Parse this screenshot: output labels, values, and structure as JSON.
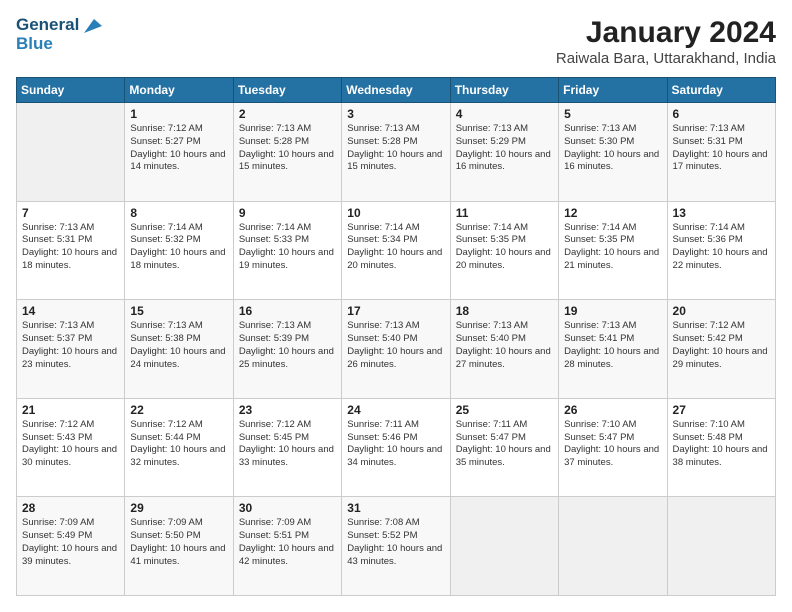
{
  "logo": {
    "line1": "General",
    "line2": "Blue"
  },
  "title": "January 2024",
  "subtitle": "Raiwala Bara, Uttarakhand, India",
  "weekdays": [
    "Sunday",
    "Monday",
    "Tuesday",
    "Wednesday",
    "Thursday",
    "Friday",
    "Saturday"
  ],
  "weeks": [
    [
      {
        "day": "",
        "sunrise": "",
        "sunset": "",
        "daylight": ""
      },
      {
        "day": "1",
        "sunrise": "Sunrise: 7:12 AM",
        "sunset": "Sunset: 5:27 PM",
        "daylight": "Daylight: 10 hours and 14 minutes."
      },
      {
        "day": "2",
        "sunrise": "Sunrise: 7:13 AM",
        "sunset": "Sunset: 5:28 PM",
        "daylight": "Daylight: 10 hours and 15 minutes."
      },
      {
        "day": "3",
        "sunrise": "Sunrise: 7:13 AM",
        "sunset": "Sunset: 5:28 PM",
        "daylight": "Daylight: 10 hours and 15 minutes."
      },
      {
        "day": "4",
        "sunrise": "Sunrise: 7:13 AM",
        "sunset": "Sunset: 5:29 PM",
        "daylight": "Daylight: 10 hours and 16 minutes."
      },
      {
        "day": "5",
        "sunrise": "Sunrise: 7:13 AM",
        "sunset": "Sunset: 5:30 PM",
        "daylight": "Daylight: 10 hours and 16 minutes."
      },
      {
        "day": "6",
        "sunrise": "Sunrise: 7:13 AM",
        "sunset": "Sunset: 5:31 PM",
        "daylight": "Daylight: 10 hours and 17 minutes."
      }
    ],
    [
      {
        "day": "7",
        "sunrise": "Sunrise: 7:13 AM",
        "sunset": "Sunset: 5:31 PM",
        "daylight": "Daylight: 10 hours and 18 minutes."
      },
      {
        "day": "8",
        "sunrise": "Sunrise: 7:14 AM",
        "sunset": "Sunset: 5:32 PM",
        "daylight": "Daylight: 10 hours and 18 minutes."
      },
      {
        "day": "9",
        "sunrise": "Sunrise: 7:14 AM",
        "sunset": "Sunset: 5:33 PM",
        "daylight": "Daylight: 10 hours and 19 minutes."
      },
      {
        "day": "10",
        "sunrise": "Sunrise: 7:14 AM",
        "sunset": "Sunset: 5:34 PM",
        "daylight": "Daylight: 10 hours and 20 minutes."
      },
      {
        "day": "11",
        "sunrise": "Sunrise: 7:14 AM",
        "sunset": "Sunset: 5:35 PM",
        "daylight": "Daylight: 10 hours and 20 minutes."
      },
      {
        "day": "12",
        "sunrise": "Sunrise: 7:14 AM",
        "sunset": "Sunset: 5:35 PM",
        "daylight": "Daylight: 10 hours and 21 minutes."
      },
      {
        "day": "13",
        "sunrise": "Sunrise: 7:14 AM",
        "sunset": "Sunset: 5:36 PM",
        "daylight": "Daylight: 10 hours and 22 minutes."
      }
    ],
    [
      {
        "day": "14",
        "sunrise": "Sunrise: 7:13 AM",
        "sunset": "Sunset: 5:37 PM",
        "daylight": "Daylight: 10 hours and 23 minutes."
      },
      {
        "day": "15",
        "sunrise": "Sunrise: 7:13 AM",
        "sunset": "Sunset: 5:38 PM",
        "daylight": "Daylight: 10 hours and 24 minutes."
      },
      {
        "day": "16",
        "sunrise": "Sunrise: 7:13 AM",
        "sunset": "Sunset: 5:39 PM",
        "daylight": "Daylight: 10 hours and 25 minutes."
      },
      {
        "day": "17",
        "sunrise": "Sunrise: 7:13 AM",
        "sunset": "Sunset: 5:40 PM",
        "daylight": "Daylight: 10 hours and 26 minutes."
      },
      {
        "day": "18",
        "sunrise": "Sunrise: 7:13 AM",
        "sunset": "Sunset: 5:40 PM",
        "daylight": "Daylight: 10 hours and 27 minutes."
      },
      {
        "day": "19",
        "sunrise": "Sunrise: 7:13 AM",
        "sunset": "Sunset: 5:41 PM",
        "daylight": "Daylight: 10 hours and 28 minutes."
      },
      {
        "day": "20",
        "sunrise": "Sunrise: 7:12 AM",
        "sunset": "Sunset: 5:42 PM",
        "daylight": "Daylight: 10 hours and 29 minutes."
      }
    ],
    [
      {
        "day": "21",
        "sunrise": "Sunrise: 7:12 AM",
        "sunset": "Sunset: 5:43 PM",
        "daylight": "Daylight: 10 hours and 30 minutes."
      },
      {
        "day": "22",
        "sunrise": "Sunrise: 7:12 AM",
        "sunset": "Sunset: 5:44 PM",
        "daylight": "Daylight: 10 hours and 32 minutes."
      },
      {
        "day": "23",
        "sunrise": "Sunrise: 7:12 AM",
        "sunset": "Sunset: 5:45 PM",
        "daylight": "Daylight: 10 hours and 33 minutes."
      },
      {
        "day": "24",
        "sunrise": "Sunrise: 7:11 AM",
        "sunset": "Sunset: 5:46 PM",
        "daylight": "Daylight: 10 hours and 34 minutes."
      },
      {
        "day": "25",
        "sunrise": "Sunrise: 7:11 AM",
        "sunset": "Sunset: 5:47 PM",
        "daylight": "Daylight: 10 hours and 35 minutes."
      },
      {
        "day": "26",
        "sunrise": "Sunrise: 7:10 AM",
        "sunset": "Sunset: 5:47 PM",
        "daylight": "Daylight: 10 hours and 37 minutes."
      },
      {
        "day": "27",
        "sunrise": "Sunrise: 7:10 AM",
        "sunset": "Sunset: 5:48 PM",
        "daylight": "Daylight: 10 hours and 38 minutes."
      }
    ],
    [
      {
        "day": "28",
        "sunrise": "Sunrise: 7:09 AM",
        "sunset": "Sunset: 5:49 PM",
        "daylight": "Daylight: 10 hours and 39 minutes."
      },
      {
        "day": "29",
        "sunrise": "Sunrise: 7:09 AM",
        "sunset": "Sunset: 5:50 PM",
        "daylight": "Daylight: 10 hours and 41 minutes."
      },
      {
        "day": "30",
        "sunrise": "Sunrise: 7:09 AM",
        "sunset": "Sunset: 5:51 PM",
        "daylight": "Daylight: 10 hours and 42 minutes."
      },
      {
        "day": "31",
        "sunrise": "Sunrise: 7:08 AM",
        "sunset": "Sunset: 5:52 PM",
        "daylight": "Daylight: 10 hours and 43 minutes."
      },
      {
        "day": "",
        "sunrise": "",
        "sunset": "",
        "daylight": ""
      },
      {
        "day": "",
        "sunrise": "",
        "sunset": "",
        "daylight": ""
      },
      {
        "day": "",
        "sunrise": "",
        "sunset": "",
        "daylight": ""
      }
    ]
  ]
}
